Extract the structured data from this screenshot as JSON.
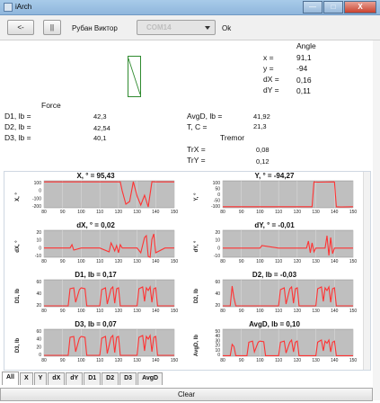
{
  "window": {
    "title": "iArch",
    "minimize": "—",
    "maximize": "□",
    "close": "X"
  },
  "toolbar": {
    "back_label": "<-",
    "pause_label": "||",
    "user": "Рубан Виктор",
    "port_value": "COM14",
    "ok_label": "Ok"
  },
  "angle": {
    "header": "Angle",
    "x_label": "x =",
    "x_value": "91,1",
    "y_label": "y =",
    "y_value": "-94",
    "dx_label": "dX =",
    "dx_value": "0,16",
    "dy_label": "dY =",
    "dy_value": "0,11"
  },
  "force": {
    "header": "Force",
    "d1_label": "D1, lb =",
    "d1_value": "42,3",
    "d2_label": "D2, lb =",
    "d2_value": "42,54",
    "d3_label": "D3, lb =",
    "d3_value": "40,1"
  },
  "metrics": {
    "avgd_label": "AvgD, lb =",
    "avgd_value": "41,92",
    "t_label": "T, C =",
    "t_value": "21,3"
  },
  "tremor": {
    "header": "Tremor",
    "trx_label": "TrX =",
    "trx_value": "0,08",
    "try_label": "TrY =",
    "try_value": "0,12"
  },
  "chart_data": [
    {
      "type": "line",
      "title": "X, ° = 95,43",
      "ylabel": "X, °",
      "xlabel": "",
      "xlim": [
        80,
        150
      ],
      "ylim": [
        -200,
        100
      ],
      "yticks": [
        "100",
        "0",
        "-100",
        "-200"
      ],
      "xticks": [
        "80",
        "90",
        "100",
        "110",
        "120",
        "130",
        "140",
        "150"
      ],
      "x": [
        80,
        95,
        110,
        121,
        122,
        124,
        126,
        128,
        130,
        132,
        134,
        136,
        138,
        140,
        145,
        150
      ],
      "y": [
        88,
        88,
        88,
        88,
        -10,
        -160,
        -130,
        90,
        -70,
        -170,
        -60,
        -190,
        90,
        88,
        88,
        88
      ]
    },
    {
      "type": "line",
      "title": "Y, ° = -94,27",
      "ylabel": "Y, °",
      "xlabel": "",
      "xlim": [
        80,
        150
      ],
      "ylim": [
        -100,
        100
      ],
      "yticks": [
        "100",
        "50",
        "0",
        "-50",
        "-100"
      ],
      "xticks": [
        "80",
        "90",
        "100",
        "110",
        "120",
        "130",
        "140",
        "150"
      ],
      "x": [
        80,
        110,
        128,
        129,
        131,
        140,
        141,
        143,
        150
      ],
      "y": [
        -92,
        -92,
        -92,
        92,
        90,
        92,
        -92,
        -94,
        -92
      ]
    },
    {
      "type": "line",
      "title": "dX, ° = 0,02",
      "ylabel": "dX, °",
      "xlabel": "",
      "xlim": [
        80,
        150
      ],
      "ylim": [
        -10,
        20
      ],
      "yticks": [
        "20",
        "10",
        "0",
        "-10"
      ],
      "xticks": [
        "80",
        "90",
        "100",
        "110",
        "120",
        "130",
        "140",
        "150"
      ],
      "x": [
        80,
        94,
        95,
        96,
        100,
        110,
        115,
        116,
        117,
        118,
        119,
        120,
        121,
        122,
        130,
        132,
        134,
        135,
        136,
        137,
        138,
        139,
        140,
        145,
        150
      ],
      "y": [
        0.3,
        0.3,
        4,
        -2,
        0.3,
        0.3,
        -4,
        6,
        2,
        -3,
        3,
        -5,
        4,
        0.3,
        0.3,
        -5,
        12,
        14,
        -9,
        -10,
        10,
        16,
        -5,
        0.3,
        0.3
      ]
    },
    {
      "type": "line",
      "title": "dY, ° = -0,01",
      "ylabel": "dY, °",
      "xlabel": "",
      "xlim": [
        80,
        150
      ],
      "ylim": [
        -10,
        20
      ],
      "yticks": [
        "20",
        "10",
        "0",
        "-10"
      ],
      "xticks": [
        "80",
        "90",
        "100",
        "110",
        "120",
        "130",
        "140",
        "150"
      ],
      "x": [
        80,
        100,
        101,
        110,
        125,
        126,
        127,
        128,
        129,
        130,
        135,
        136,
        137,
        138,
        139,
        140,
        145,
        150
      ],
      "y": [
        0.2,
        0.2,
        3,
        0.2,
        0.2,
        8,
        -5,
        6,
        -4,
        0.2,
        0.2,
        14,
        -8,
        12,
        -6,
        0.2,
        0.2,
        0.2
      ]
    },
    {
      "type": "line",
      "title": "D1, lb = 0,17",
      "ylabel": "D1, lb",
      "xlabel": "",
      "xlim": [
        80,
        150
      ],
      "ylim": [
        0,
        60
      ],
      "yticks": [
        "60",
        "40",
        "20"
      ],
      "xticks": [
        "80",
        "90",
        "100",
        "110",
        "120",
        "130",
        "140",
        "150"
      ],
      "x": [
        80,
        93,
        94,
        96,
        97,
        99,
        100,
        102,
        103,
        110,
        111,
        113,
        114,
        116,
        117,
        118,
        119,
        120,
        121,
        130,
        131,
        133,
        134,
        135,
        136,
        137,
        138,
        139,
        140,
        141,
        150
      ],
      "y": [
        2,
        2,
        40,
        42,
        10,
        38,
        42,
        40,
        2,
        2,
        38,
        42,
        6,
        40,
        44,
        8,
        40,
        42,
        2,
        2,
        40,
        44,
        12,
        42,
        36,
        44,
        10,
        40,
        42,
        2,
        2
      ]
    },
    {
      "type": "line",
      "title": "D2, lb = -0,03",
      "ylabel": "D2, lb",
      "xlabel": "",
      "xlim": [
        80,
        150
      ],
      "ylim": [
        0,
        60
      ],
      "yticks": [
        "60",
        "40",
        "20"
      ],
      "xticks": [
        "80",
        "90",
        "100",
        "110",
        "120",
        "130",
        "140",
        "150"
      ],
      "x": [
        80,
        84,
        85,
        86,
        87,
        110,
        111,
        113,
        114,
        116,
        117,
        118,
        119,
        120,
        121,
        130,
        131,
        133,
        134,
        135,
        136,
        137,
        138,
        139,
        140,
        141,
        150
      ],
      "y": [
        2,
        2,
        46,
        20,
        2,
        2,
        38,
        42,
        6,
        40,
        44,
        8,
        40,
        42,
        2,
        2,
        40,
        44,
        12,
        42,
        36,
        44,
        10,
        40,
        42,
        2,
        2
      ]
    },
    {
      "type": "line",
      "title": "D3, lb = 0,07",
      "ylabel": "D3, lb",
      "xlabel": "",
      "xlim": [
        80,
        150
      ],
      "ylim": [
        0,
        60
      ],
      "yticks": [
        "60",
        "40",
        "20",
        "0"
      ],
      "xticks": [
        "80",
        "90",
        "100",
        "110",
        "120",
        "130",
        "140",
        "150"
      ],
      "x": [
        80,
        93,
        94,
        96,
        97,
        99,
        100,
        102,
        103,
        110,
        111,
        113,
        114,
        116,
        117,
        118,
        119,
        120,
        121,
        130,
        131,
        133,
        134,
        135,
        136,
        137,
        138,
        139,
        140,
        141,
        150
      ],
      "y": [
        2,
        2,
        42,
        44,
        10,
        40,
        44,
        42,
        2,
        2,
        40,
        44,
        6,
        42,
        46,
        8,
        42,
        44,
        2,
        2,
        42,
        46,
        12,
        44,
        38,
        46,
        10,
        42,
        44,
        2,
        2
      ]
    },
    {
      "type": "line",
      "title": "AvgD, lb = 0,10",
      "ylabel": "AvgD, lb",
      "xlabel": "",
      "xlim": [
        80,
        150
      ],
      "ylim": [
        0,
        50
      ],
      "yticks": [
        "50",
        "40",
        "30",
        "20",
        "10",
        "0"
      ],
      "xticks": [
        "80",
        "90",
        "100",
        "110",
        "120",
        "130",
        "140",
        "150"
      ],
      "x": [
        80,
        84,
        85,
        86,
        87,
        93,
        94,
        96,
        97,
        99,
        100,
        102,
        103,
        110,
        111,
        113,
        114,
        116,
        117,
        118,
        119,
        120,
        121,
        130,
        131,
        133,
        134,
        135,
        136,
        137,
        138,
        139,
        140,
        141,
        150
      ],
      "y": [
        1,
        1,
        22,
        18,
        1,
        1,
        26,
        28,
        8,
        26,
        28,
        27,
        1,
        1,
        26,
        28,
        6,
        26,
        30,
        8,
        26,
        28,
        1,
        1,
        26,
        30,
        10,
        28,
        24,
        30,
        8,
        26,
        28,
        1,
        1
      ]
    }
  ],
  "tabs": [
    "All",
    "X",
    "Y",
    "dX",
    "dY",
    "D1",
    "D2",
    "D3",
    "AvgD"
  ],
  "clear_label": "Clear",
  "colors": {
    "line": "#ff3333",
    "plot_bg": "#bfbfbf",
    "indicator": "#2f8a2f"
  }
}
